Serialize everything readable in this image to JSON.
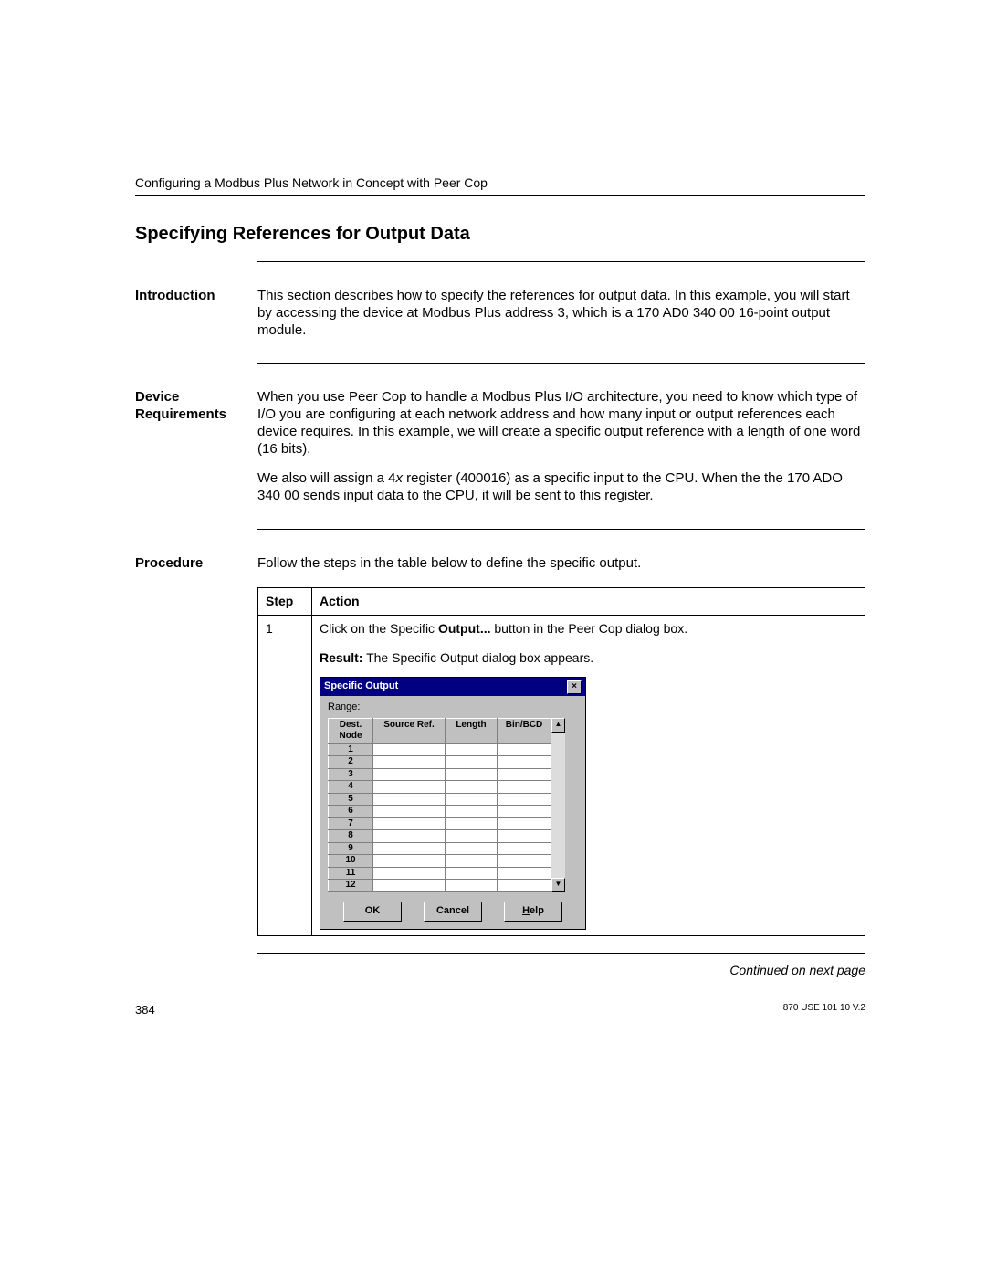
{
  "header": {
    "running_head": "Configuring a Modbus Plus Network in Concept with Peer Cop"
  },
  "title": "Specifying References for Output Data",
  "sections": {
    "intro": {
      "head": "Introduction",
      "p1": "This section describes how to specify the references for output data. In this example, you will start by accessing the device at Modbus Plus address 3, which is a 170 AD0 340 00 16-point output module."
    },
    "devreq": {
      "head": "Device Requirements",
      "p1": "When you use Peer Cop to handle a Modbus Plus I/O architecture, you need to know which type of I/O you are configuring at each network address and how many input or output references each device requires. In this example, we will create a specific output reference with a length of one word (16 bits).",
      "p2a": "We also will assign a 4",
      "p2b": "x",
      "p2c": " register (400016) as a specific input to the CPU. When the the 170 ADO 340 00 sends input data to the CPU, it will be sent to this register."
    },
    "proc": {
      "head": "Procedure",
      "intro": "Follow the steps in the table below to define the specific output.",
      "th_step": "Step",
      "th_action": "Action",
      "step_num": "1",
      "action_line1a": "Click on the Specific ",
      "action_line1b": "Output...",
      "action_line1c": " button in the Peer Cop dialog box.",
      "result_label": "Result:",
      "result_text": " The Specific Output dialog box appears."
    }
  },
  "dialog": {
    "title": "Specific Output",
    "close": "×",
    "range_label": "Range:",
    "headers": {
      "dest": "Dest. Node",
      "src": "Source Ref.",
      "len": "Length",
      "bin": "Bin/BCD"
    },
    "rows": [
      "1",
      "2",
      "3",
      "4",
      "5",
      "6",
      "7",
      "8",
      "9",
      "10",
      "11",
      "12"
    ],
    "scroll_up": "▲",
    "scroll_down": "▼",
    "buttons": {
      "ok": "OK",
      "cancel": "Cancel",
      "help": "Help"
    }
  },
  "continued": "Continued on next page",
  "footer": {
    "page": "384",
    "docid": "870 USE 101 10 V.2"
  }
}
